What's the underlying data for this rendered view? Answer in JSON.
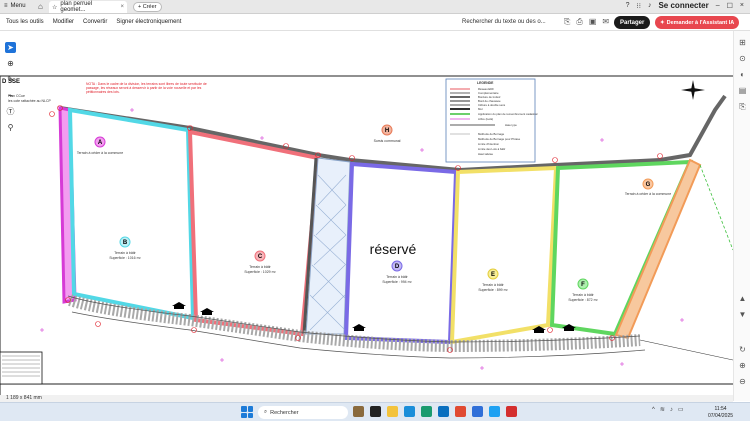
{
  "browser": {
    "menu_label": "Menu",
    "tab_title": "plan perruel geomet...",
    "create_label": "+ Créer",
    "connect_label": "Se connecter"
  },
  "toolbar": {
    "menu_items": [
      "Tous les outils",
      "Modifier",
      "Convertir",
      "Signer électroniquement"
    ],
    "search_text": "Rechercher du texte ou des o...",
    "share_label": "Partager",
    "ai_label": "Demander à l'Assistant IA"
  },
  "plan": {
    "lots": [
      {
        "letter": "A",
        "desc": "Terrain à céder à la commune",
        "color": "#d63bd6"
      },
      {
        "letter": "B",
        "desc": "Terrain à bâtir",
        "area": "Superficie : 1016 m²",
        "color": "#52d8e6"
      },
      {
        "letter": "C",
        "desc": "Terrain à bâtir",
        "area": "Superficie : 1029 m²",
        "color": "#f0707a"
      },
      {
        "letter": "D",
        "desc": "Terrain à bâtir",
        "area": "Superficie : 994 m²",
        "color": "#7a6ae6"
      },
      {
        "letter": "E",
        "desc": "Terrain à bâtir",
        "area": "Superficie : 899 m²",
        "color": "#f2e067"
      },
      {
        "letter": "F",
        "desc": "Terrain à bâtir",
        "area": "Superficie : 872 m²",
        "color": "#5fd65f"
      },
      {
        "letter": "G",
        "desc": "Terrain à céder à la commune",
        "color": "#f29b58"
      },
      {
        "letter": "H",
        "desc": "Sursis communal",
        "color": "#e87a57"
      }
    ],
    "reserved_label": "réservé",
    "title_fragment": "D     SSE",
    "left_note_1": "Plan CCue",
    "left_note_2": "les cote rattachée au NLCP",
    "red_note": "NOTA : Dans le cadre de la division, les terrains sont libres de toute servitude de passage, les réseaux seront à desservir à partir de la voie nouvelle et par les pétitionnaires des lots.",
    "legend_title": "LEGENDE",
    "legend_items": [
      "Réseau EDF",
      "Complémentaire",
      "Bordure de trottoir",
      "Bord de chaussée",
      "Clôture à double sens",
      "Mur",
      "Application du plan de remembrement cadastral",
      "Arbre (isolé)",
      "Haie type",
      "Méthode de Bornage",
      "Méthode de Bornage pour Phrase",
      "Limite d'Intention",
      "Limite des Lots à bâtir"
    ],
    "dim_note": "Haut talutée",
    "scale": "1 189 x 841 mm"
  },
  "taskbar": {
    "search_placeholder": "Rechercher",
    "time": "11:54",
    "date": "07/04/2025"
  }
}
